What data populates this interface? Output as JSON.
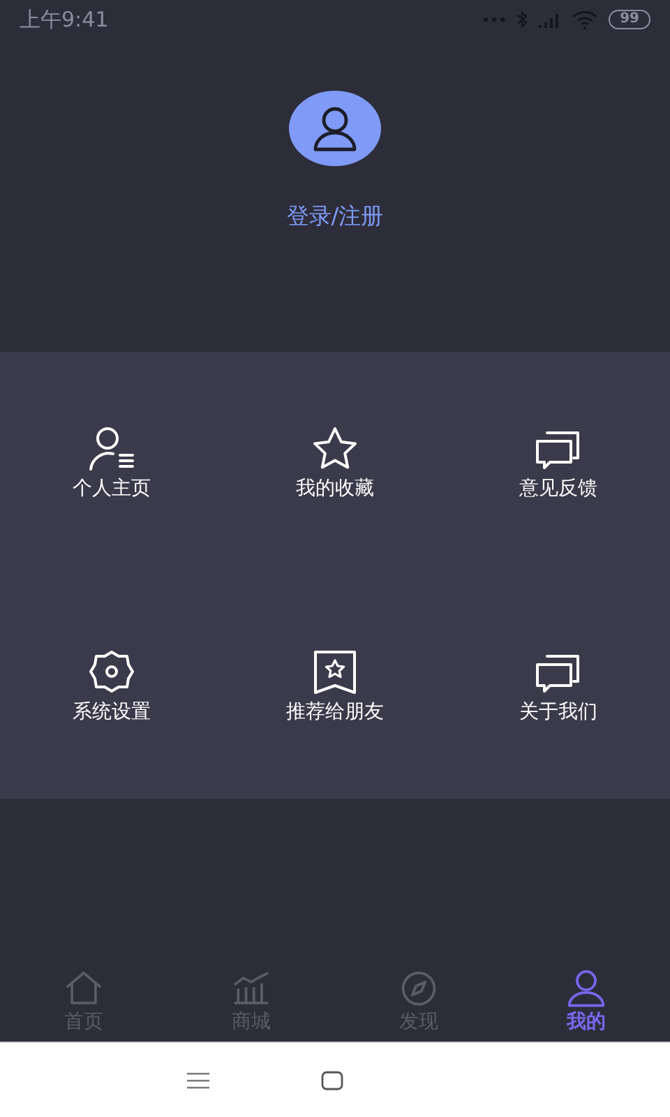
{
  "status_bar": {
    "time": "上午9:41",
    "battery": "99"
  },
  "profile": {
    "login_link": "登录/注册"
  },
  "menu": [
    {
      "label": "个人主页"
    },
    {
      "label": "我的收藏"
    },
    {
      "label": "意见反馈"
    },
    {
      "label": "系统设置"
    },
    {
      "label": "推荐给朋友"
    },
    {
      "label": "关于我们"
    }
  ],
  "tabs": [
    {
      "label": "首页",
      "selected": false
    },
    {
      "label": "商城",
      "selected": false
    },
    {
      "label": "发现",
      "selected": false
    },
    {
      "label": "我的",
      "selected": true
    }
  ]
}
